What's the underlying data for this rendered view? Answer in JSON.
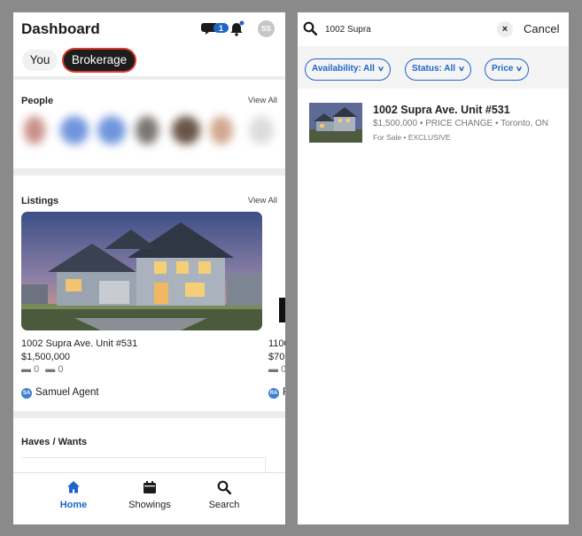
{
  "left": {
    "title": "Dashboard",
    "chat_badge": "1",
    "avatar_initials": "SS",
    "segments": {
      "you": "You",
      "brokerage": "Brokerage"
    },
    "people": {
      "title": "People",
      "view_all": "View All"
    },
    "listings": {
      "title": "Listings",
      "view_all": "View All",
      "items": [
        {
          "name": "1002 Supra Ave. Unit #531",
          "price": "$1,500,000",
          "beds": "0",
          "baths": "0",
          "agent_initials": "SA",
          "agent_name": "Samuel  Agent"
        },
        {
          "name": "1100",
          "price": "$70",
          "beds": "0",
          "baths": "",
          "agent_initials": "RA",
          "agent_name": "F"
        }
      ]
    },
    "haves_wants": {
      "title": "Haves / Wants"
    },
    "nav": [
      {
        "label": "Home",
        "icon": "home-icon"
      },
      {
        "label": "Showings",
        "icon": "calendar-icon"
      },
      {
        "label": "Search",
        "icon": "search-icon"
      }
    ]
  },
  "right": {
    "search": {
      "value": "1002 Supra",
      "placeholder": ""
    },
    "clear_label": "×",
    "cancel_label": "Cancel",
    "filters": [
      {
        "label": "Availability: All"
      },
      {
        "label": "Status: All"
      },
      {
        "label": "Price"
      }
    ],
    "result": {
      "title": "1002 Supra Ave. Unit #531",
      "subtitle": "$1,500,000 • PRICE CHANGE • Toronto, ON",
      "tags": "For Sale • EXCLUSIVE"
    }
  },
  "colors": {
    "accent": "#1d65c9",
    "highlight": "#d93a2b",
    "frame": "#8a8a8a"
  }
}
